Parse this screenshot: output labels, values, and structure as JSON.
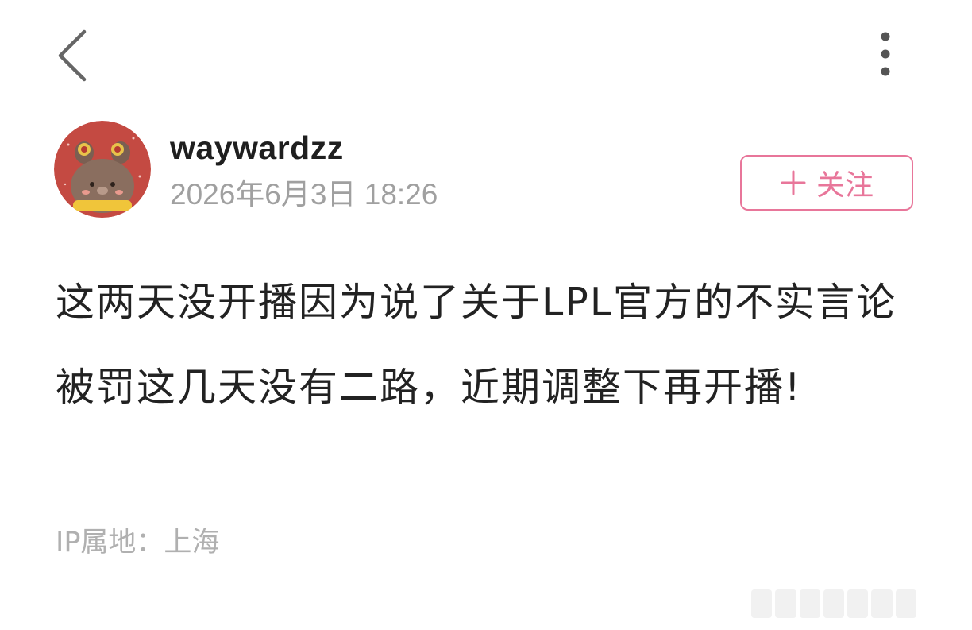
{
  "header": {
    "back_icon": "chevron-left-icon",
    "more_icon": "vertical-dots-icon"
  },
  "author": {
    "username": "waywardzz",
    "timestamp": "2026年6月3日 18:26",
    "avatar_icon": "bear-avatar"
  },
  "follow": {
    "label": "关注",
    "icon": "plus-icon",
    "color": "#e8769a"
  },
  "post": {
    "text": "这两天没开播因为说了关于LPL官方的不实言论被罚这几天没有二路，近期调整下再开播!"
  },
  "footer": {
    "ip_location": "IP属地：上海"
  }
}
